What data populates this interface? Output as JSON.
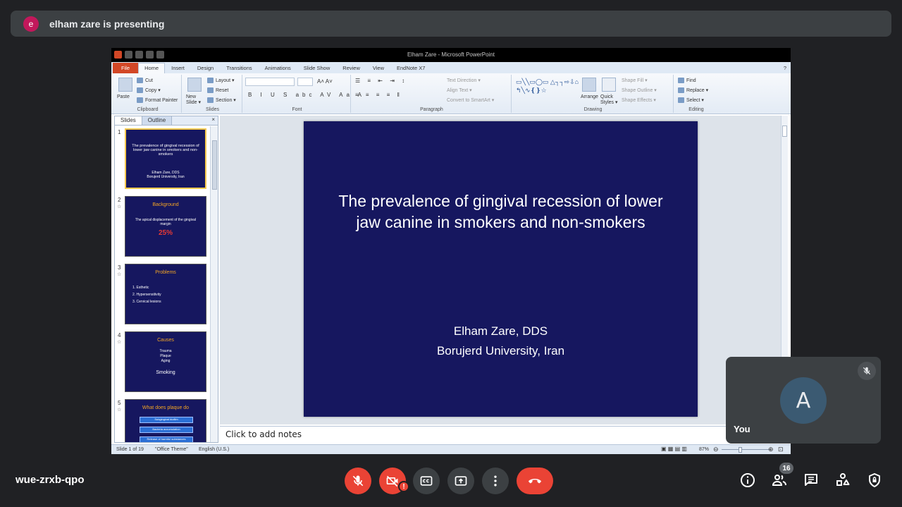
{
  "banner": {
    "avatar_letter": "e",
    "text": "elham zare is presenting"
  },
  "ppt": {
    "window_title": "Elham Zare - Microsoft PowerPoint",
    "tabs": [
      "File",
      "Home",
      "Insert",
      "Design",
      "Transitions",
      "Animations",
      "Slide Show",
      "Review",
      "View",
      "EndNote X7"
    ],
    "ribbon": {
      "clipboard": {
        "paste": "Paste",
        "cut": "Cut",
        "copy": "Copy ▾",
        "format_painter": "Format Painter",
        "label": "Clipboard"
      },
      "slides": {
        "new_slide": "New Slide ▾",
        "layout": "Layout ▾",
        "reset": "Reset",
        "section": "Section ▾",
        "label": "Slides"
      },
      "font": {
        "label": "Font"
      },
      "paragraph": {
        "text_direction": "Text Direction ▾",
        "align_text": "Align Text ▾",
        "convert": "Convert to SmartArt ▾",
        "label": "Paragraph"
      },
      "drawing": {
        "arrange": "Arrange",
        "quick_styles": "Quick Styles ▾",
        "shape_fill": "Shape Fill ▾",
        "shape_outline": "Shape Outline ▾",
        "shape_effects": "Shape Effects ▾",
        "label": "Drawing"
      },
      "editing": {
        "find": "Find",
        "replace": "Replace ▾",
        "select": "Select ▾",
        "label": "Editing"
      }
    },
    "pane_tabs": {
      "slides": "Slides",
      "outline": "Outline",
      "close": "×"
    },
    "thumbnails": [
      {
        "num": "1",
        "title": "The prevalence of gingival recession of lower jaw canine in smokers and non-smokers",
        "author": "Elham Zare, DDS",
        "affiliation": "Borujerd University, Iran"
      },
      {
        "num": "2",
        "title": "Background",
        "text": "The apical displacement of the gingival margin",
        "stat": "25%"
      },
      {
        "num": "3",
        "title": "Problems",
        "items": [
          "1.  Esthetic",
          "2.  Hypersensitivity",
          "3.  Cervical lesions"
        ]
      },
      {
        "num": "4",
        "title": "Causes",
        "items": [
          "Trauma",
          "Plaque",
          "Aging"
        ],
        "extra": "Smoking"
      },
      {
        "num": "5",
        "title": "What does plaque do",
        "boxes": [
          "Subgingival biofilm",
          "Bacteria accumulation",
          "Release of harmful substances"
        ]
      }
    ],
    "slide": {
      "title": "The prevalence of gingival recession of lower jaw canine in smokers and non-smokers",
      "author": "Elham Zare, DDS",
      "affiliation": "Borujerd University, Iran"
    },
    "notes_placeholder": "Click to add notes",
    "status": {
      "slide": "Slide 1 of 19",
      "theme": "\"Office Theme\"",
      "language": "English (U.S.)",
      "zoom": "87%"
    }
  },
  "self_tile": {
    "avatar_letter": "A",
    "name": "You"
  },
  "meeting": {
    "code": "wue-zrxb-qpo",
    "participants": "16",
    "camera_warning": "!"
  },
  "colors": {
    "end_call": "#ea4335",
    "slide_bg": "#16175f",
    "accent_orange": "#f5a623"
  }
}
